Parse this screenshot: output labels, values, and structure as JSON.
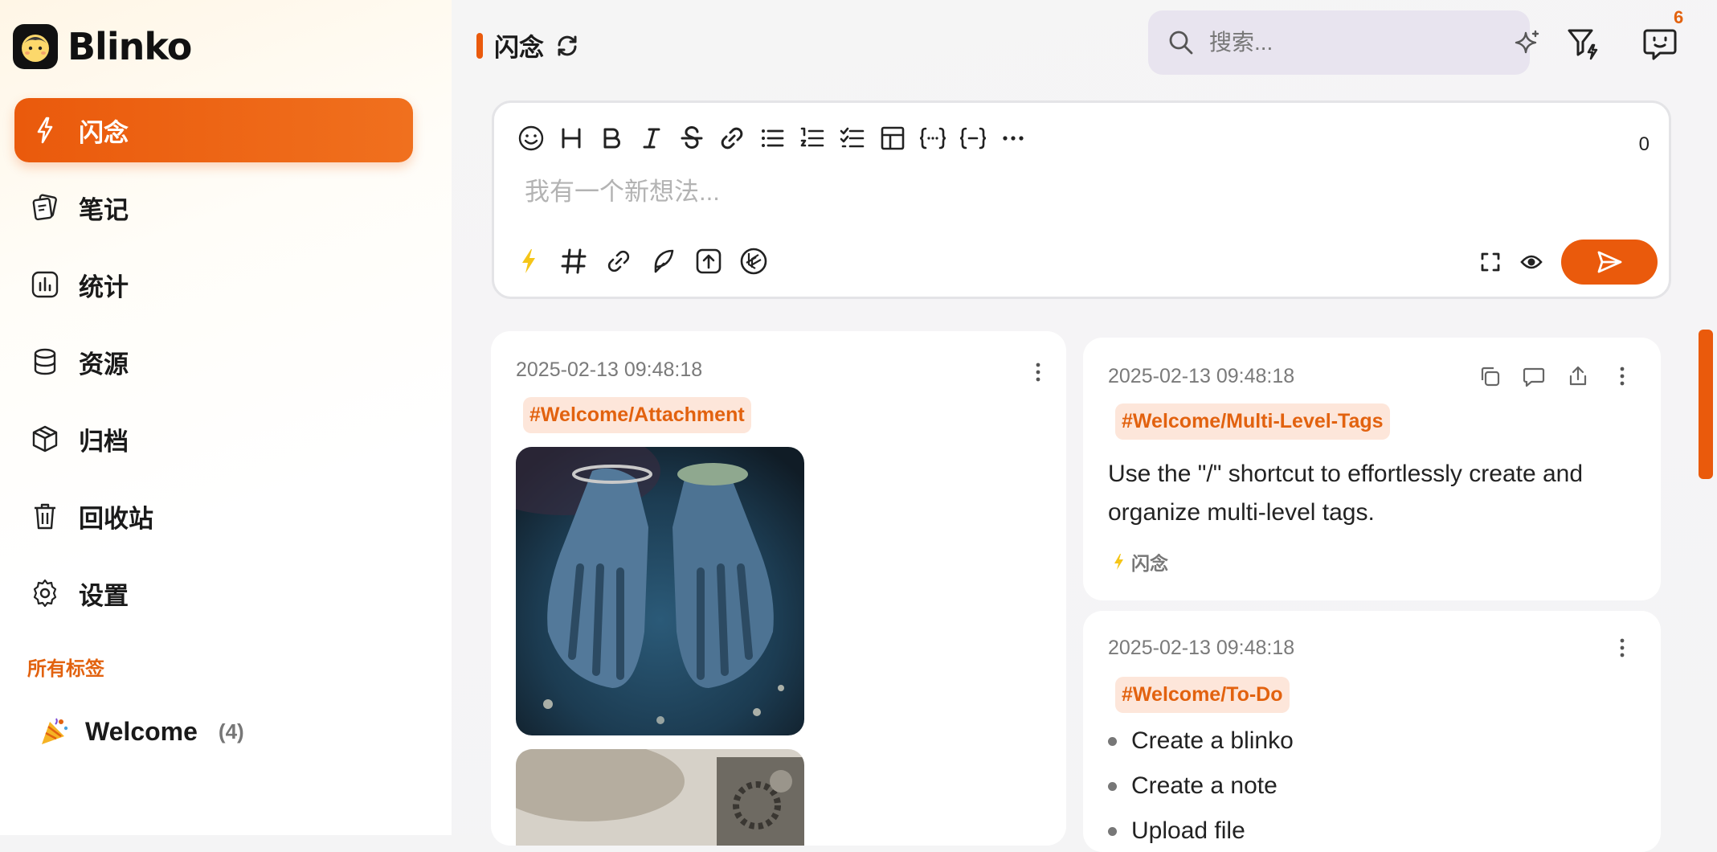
{
  "app": {
    "name": "Blinko"
  },
  "sidebar": {
    "items": [
      {
        "label": "闪念",
        "icon": "flash-icon",
        "active": true
      },
      {
        "label": "笔记",
        "icon": "notes-icon",
        "active": false
      },
      {
        "label": "统计",
        "icon": "stats-icon",
        "active": false
      },
      {
        "label": "资源",
        "icon": "database-icon",
        "active": false
      },
      {
        "label": "归档",
        "icon": "archive-box-icon",
        "active": false
      },
      {
        "label": "回收站",
        "icon": "trash-icon",
        "active": false
      },
      {
        "label": "设置",
        "icon": "gear-icon",
        "active": false
      }
    ],
    "tags_title": "所有标签",
    "tags": [
      {
        "emoji_icon": "party-popper-icon",
        "name": "Welcome",
        "count": "(4)"
      }
    ]
  },
  "header": {
    "title": "闪念",
    "search_placeholder": "搜索...",
    "notification_count": "6"
  },
  "editor": {
    "placeholder": "我有一个新想法...",
    "char_count": "0",
    "toolbar_icons": [
      "emoji-icon",
      "heading-icon",
      "bold-icon",
      "italic-icon",
      "strikethrough-icon",
      "link-icon",
      "bullet-list-icon",
      "numbered-list-icon",
      "checklist-icon",
      "table-icon",
      "code-block-icon",
      "code-inline-icon",
      "more-icon"
    ],
    "bottom_icons": [
      "flash-type-icon",
      "hashtag-icon",
      "link-icon",
      "feather-icon",
      "upload-icon",
      "ai-icon"
    ]
  },
  "cards": [
    {
      "date": "2025-02-13 09:48:18",
      "tag": "#Welcome/Attachment"
    },
    {
      "date": "2025-02-13 09:48:18",
      "tag": "#Welcome/Multi-Level-Tags",
      "text": "Use the \"/\" shortcut to effortlessly create and organize multi-level tags.",
      "type_label": "闪念"
    },
    {
      "date": "2025-02-13 09:48:18",
      "tag": "#Welcome/To-Do",
      "items": [
        "Create a blinko",
        "Create a note",
        "Upload file"
      ]
    }
  ],
  "colors": {
    "accent": "#ea5a0c",
    "tag_bg": "#fde6da",
    "tag_text": "#e2620f"
  }
}
